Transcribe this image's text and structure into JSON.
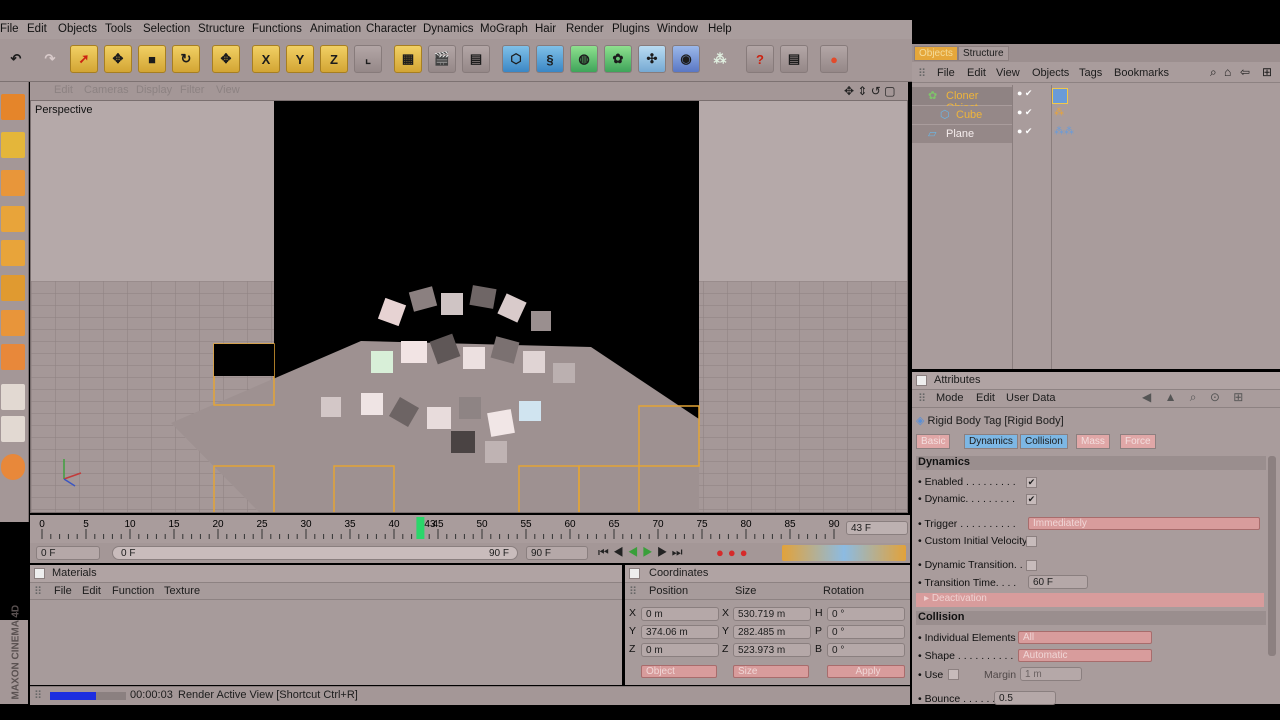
{
  "menubar": [
    "File",
    "Edit",
    "Objects",
    "Tools",
    "Selection",
    "Structure",
    "Functions",
    "Animation",
    "Character",
    "Dynamics",
    "MoGraph",
    "Hair",
    "Render",
    "Plugins",
    "Window",
    "Help"
  ],
  "toolbar": {
    "x_label": "X",
    "y_label": "Y",
    "z_label": "Z"
  },
  "viewport": {
    "menu": [
      "Edit",
      "Cameras",
      "Display",
      "Filter",
      "View"
    ],
    "label": "Perspective"
  },
  "timeline": {
    "ticks": [
      "0",
      "5",
      "10",
      "15",
      "20",
      "25",
      "30",
      "35",
      "40",
      "45",
      "50",
      "55",
      "60",
      "65",
      "70",
      "75",
      "80",
      "85",
      "90"
    ],
    "current_frame_label": "43",
    "current_frame": 43,
    "end_field": "43 F",
    "start_field": "0 F",
    "slider_start": "0 F",
    "slider_end": "90 F",
    "max_field": "90 F"
  },
  "materials": {
    "title": "Materials",
    "menu": [
      "File",
      "Edit",
      "Function",
      "Texture"
    ]
  },
  "coordinates": {
    "title": "Coordinates",
    "headers": [
      "Position",
      "Size",
      "Rotation"
    ],
    "rows": [
      {
        "axis": "X",
        "pos": "0 m",
        "size_axis": "X",
        "size": "530.719 m",
        "rot_axis": "H",
        "rot": "0 °"
      },
      {
        "axis": "Y",
        "pos": "374.06 m",
        "size_axis": "Y",
        "size": "282.485 m",
        "rot_axis": "P",
        "rot": "0 °"
      },
      {
        "axis": "Z",
        "pos": "0 m",
        "size_axis": "Z",
        "size": "523.973 m",
        "rot_axis": "B",
        "rot": "0 °"
      }
    ],
    "mode1": "Object",
    "mode2": "Size",
    "apply": "Apply"
  },
  "status": {
    "time": "00:00:03",
    "text": "Render Active View [Shortcut Ctrl+R]",
    "progress": 0.6
  },
  "objmgr": {
    "tabs": [
      "Objects",
      "Structure"
    ],
    "menu": [
      "File",
      "Edit",
      "View",
      "Objects",
      "Tags",
      "Bookmarks"
    ],
    "objects": [
      "Cloner Object",
      "Cube",
      "Plane"
    ]
  },
  "attributes": {
    "title": "Attributes",
    "menu": [
      "Mode",
      "Edit",
      "User Data"
    ],
    "tag_name": "Rigid Body Tag [Rigid Body]",
    "tabs": [
      "Basic",
      "Dynamics",
      "Collision",
      "Mass",
      "Force"
    ],
    "dynamics_header": "Dynamics",
    "enabled": "Enabled . . . . . . . . .",
    "dynamic": "Dynamic. . . . . . . . .",
    "trigger": "Trigger . . . . . . . . . .",
    "trigger_value": "Immediately",
    "civ": "Custom Initial Velocity",
    "dyn_transition": "Dynamic Transition. .",
    "transition_time": "Transition Time. . . .",
    "transition_value": "60 F",
    "deactivation": "Deactivation",
    "collision_header": "Collision",
    "ind_elements": "Individual Elements",
    "ind_value": "All",
    "shape": "Shape . . . . . . . . . .",
    "shape_value": "Automatic",
    "use": "Use",
    "margin": "Margin",
    "margin_value": "1 m",
    "bounce": "Bounce . . . . . . . . .",
    "bounce_value": "0.5"
  },
  "brand": "MAXON CINEMA 4D"
}
